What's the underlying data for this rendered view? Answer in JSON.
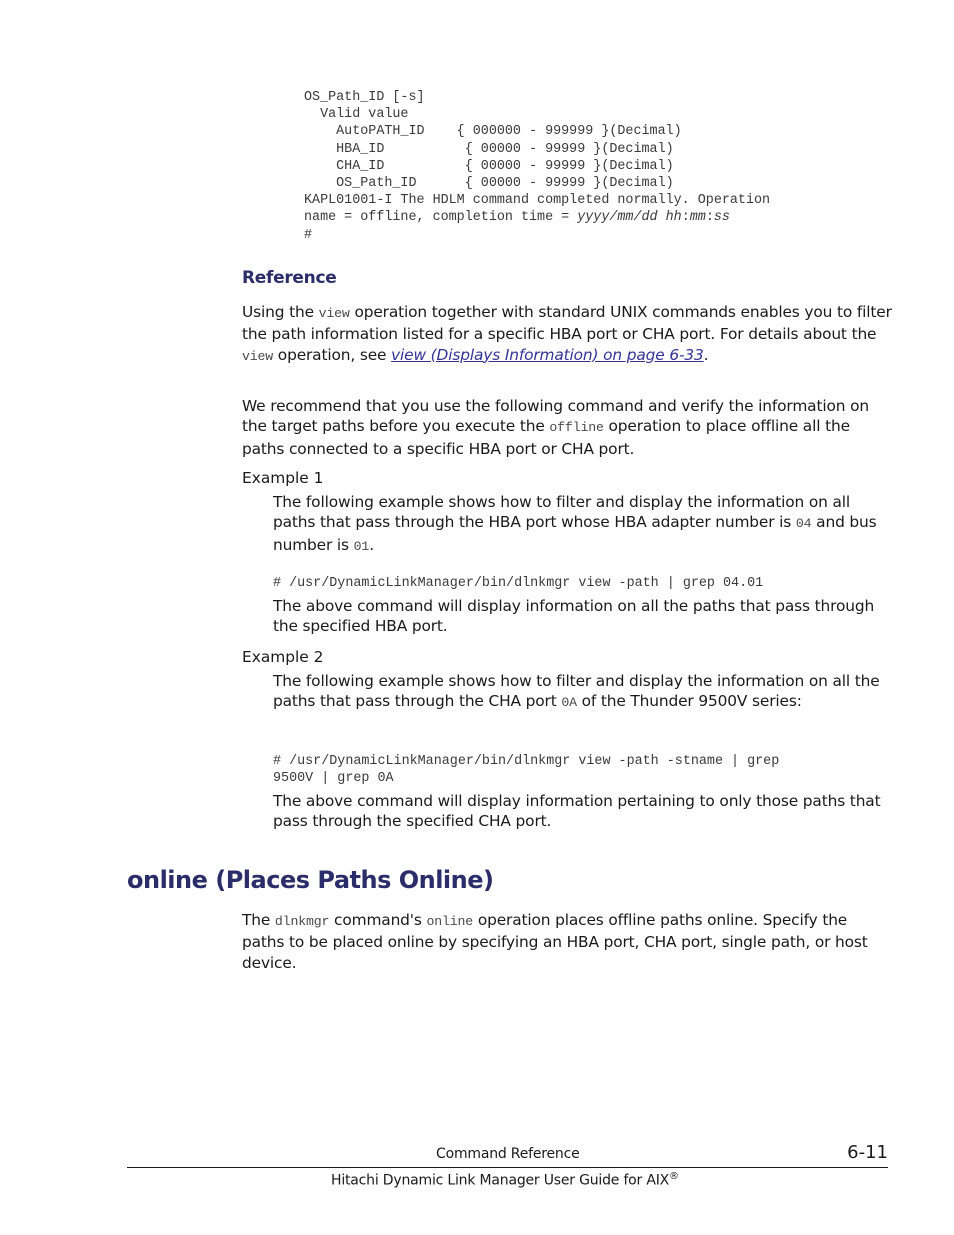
{
  "code_block": {
    "lines": [
      "OS_Path_ID [-s]",
      "  Valid value",
      "    AutoPATH_ID    { 000000 - 999999 }(Decimal)",
      "    HBA_ID          { 00000 - 99999 }(Decimal)",
      "    CHA_ID          { 00000 - 99999 }(Decimal)",
      "    OS_Path_ID      { 00000 - 99999 }(Decimal)",
      "KAPL01001-I The HDLM command completed normally. Operation"
    ],
    "last_line_prefix": "name = offline, completion time = ",
    "last_line_date": "yyyy/mm/dd hh",
    "last_line_sep1": ":",
    "last_line_mm": "mm",
    "last_line_sep2": ":",
    "last_line_ss": "ss",
    "prompt": "#"
  },
  "reference": {
    "heading": "Reference",
    "p1": {
      "t1": "Using the ",
      "code1": "view",
      "t2": " operation together with standard UNIX commands enables you to filter the path information listed for a specific HBA port or CHA port. For details about the ",
      "code2": "view",
      "t3": " operation, see ",
      "link": "view (Displays Information) on page 6-33",
      "t4": "."
    },
    "p2": {
      "t1": "We recommend that you use the following command and verify the information on the target paths before you execute the ",
      "code1": "offline",
      "t2": " operation to place offline all the paths connected to a specific HBA port or CHA port."
    },
    "example1": {
      "label": "Example 1",
      "desc_t1": "The following example shows how to filter and display the information on all paths that pass through the HBA port whose HBA adapter number is ",
      "desc_code1": "04",
      "desc_t2": " and bus number is ",
      "desc_code2": "01",
      "desc_t3": ".",
      "command": "# /usr/DynamicLinkManager/bin/dlnkmgr view -path | grep 04.01",
      "result": "The above command will display information on all the paths that pass through the specified HBA port."
    },
    "example2": {
      "label": "Example 2",
      "desc_t1": "The following example shows how to filter and display the information on all the paths that pass through the CHA port ",
      "desc_code1": "0A",
      "desc_t2": " of the Thunder 9500V series:",
      "command_line1": "# /usr/DynamicLinkManager/bin/dlnkmgr view -path -stname | grep",
      "command_line2": "9500V | grep 0A",
      "result": "The above command will display information pertaining to only those paths that pass through the specified CHA port."
    }
  },
  "online_section": {
    "heading": "online (Places Paths Online)",
    "t1": "The ",
    "code1": "dlnkmgr",
    "t2": " command's ",
    "code2": "online",
    "t3": " operation places offline paths online. Specify the paths to be placed online by specifying an HBA port, CHA port, single path, or host device."
  },
  "footer": {
    "section": "Command Reference",
    "page_number": "6-11",
    "title": "Hitachi Dynamic Link Manager User Guide for AIX",
    "registered": "®"
  }
}
